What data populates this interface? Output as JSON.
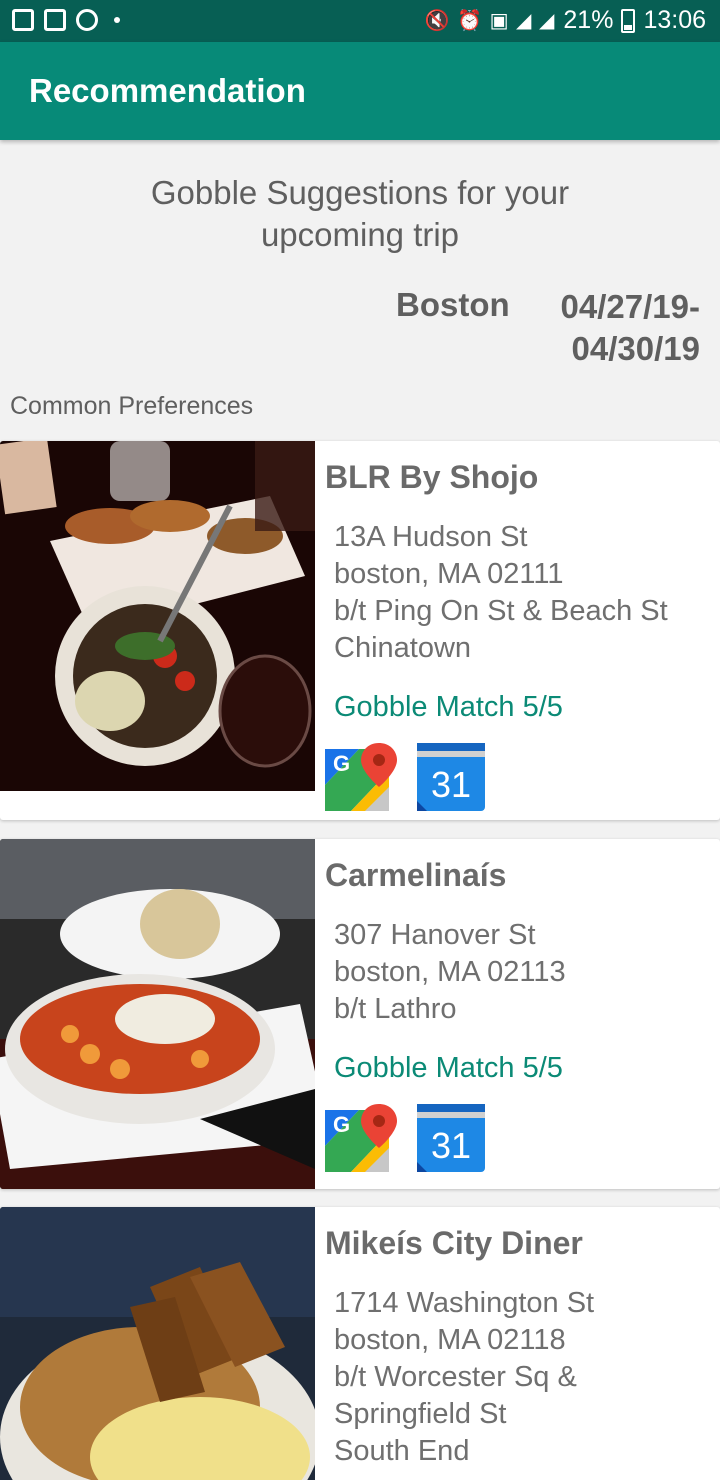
{
  "status": {
    "battery": "21%",
    "time": "13:06"
  },
  "appbar": {
    "title": "Recommendation"
  },
  "header": {
    "suggestion_line1": "Gobble Suggestions for your",
    "suggestion_line2": "upcoming trip",
    "city": "Boston",
    "date_start": "04/27/19-",
    "date_end": "04/30/19",
    "common_preferences": "Common Preferences"
  },
  "restaurants": [
    {
      "name": "BLR By Shojo",
      "address": "13A Hudson St\nboston, MA 02111\nb/t Ping On St & Beach St\nChinatown",
      "match": "Gobble Match 5/5",
      "maps_icon": "google-maps-icon",
      "calendar_icon": "calendar-icon",
      "calendar_day": "31"
    },
    {
      "name": "Carmelinaís",
      "address": "307 Hanover St\nboston, MA 02113\nb/t Lathro",
      "match": "Gobble Match 5/5",
      "maps_icon": "google-maps-icon",
      "calendar_icon": "calendar-icon",
      "calendar_day": "31"
    },
    {
      "name": "Mikeís City Diner",
      "address": "1714 Washington St\nboston, MA 02118\nb/t Worcester Sq &\nSpringfield St\nSouth End"
    }
  ]
}
